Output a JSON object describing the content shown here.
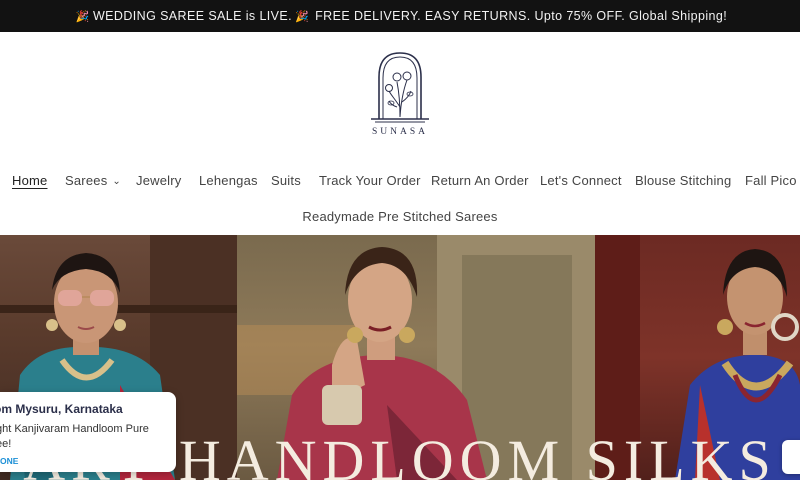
{
  "announcement": {
    "part1": "WEDDING SAREE SALE is LIVE.",
    "part2": "FREE DELIVERY. EASY RETURNS. Upto 75% OFF. Global Shipping!",
    "icon": "party-popper-icon"
  },
  "brand": {
    "name": "SUNASA"
  },
  "nav": {
    "items": [
      {
        "label": "Home"
      },
      {
        "label": "Sarees"
      },
      {
        "label": "Jewelry"
      },
      {
        "label": "Lehengas"
      },
      {
        "label": "Suits"
      },
      {
        "label": "Track Your Order"
      },
      {
        "label": "Return An Order"
      },
      {
        "label": "Let's Connect"
      },
      {
        "label": "Blouse Stitching"
      },
      {
        "label": "Fall Pico"
      }
    ],
    "second_row": "Readymade Pre Stitched Sarees",
    "active": "Home"
  },
  "hero": {
    "headline": "ARY HANDLOOM SILKS"
  },
  "toast": {
    "location": "om Mysuru, Karnataka",
    "product": "ght Kanjivaram Handloom Pure",
    "product_cont": "ee!",
    "status": "ONE"
  },
  "colors": {
    "announcement_bg": "#121212",
    "brand": "#2b2f4a",
    "toast_link": "#1b8fd6"
  }
}
